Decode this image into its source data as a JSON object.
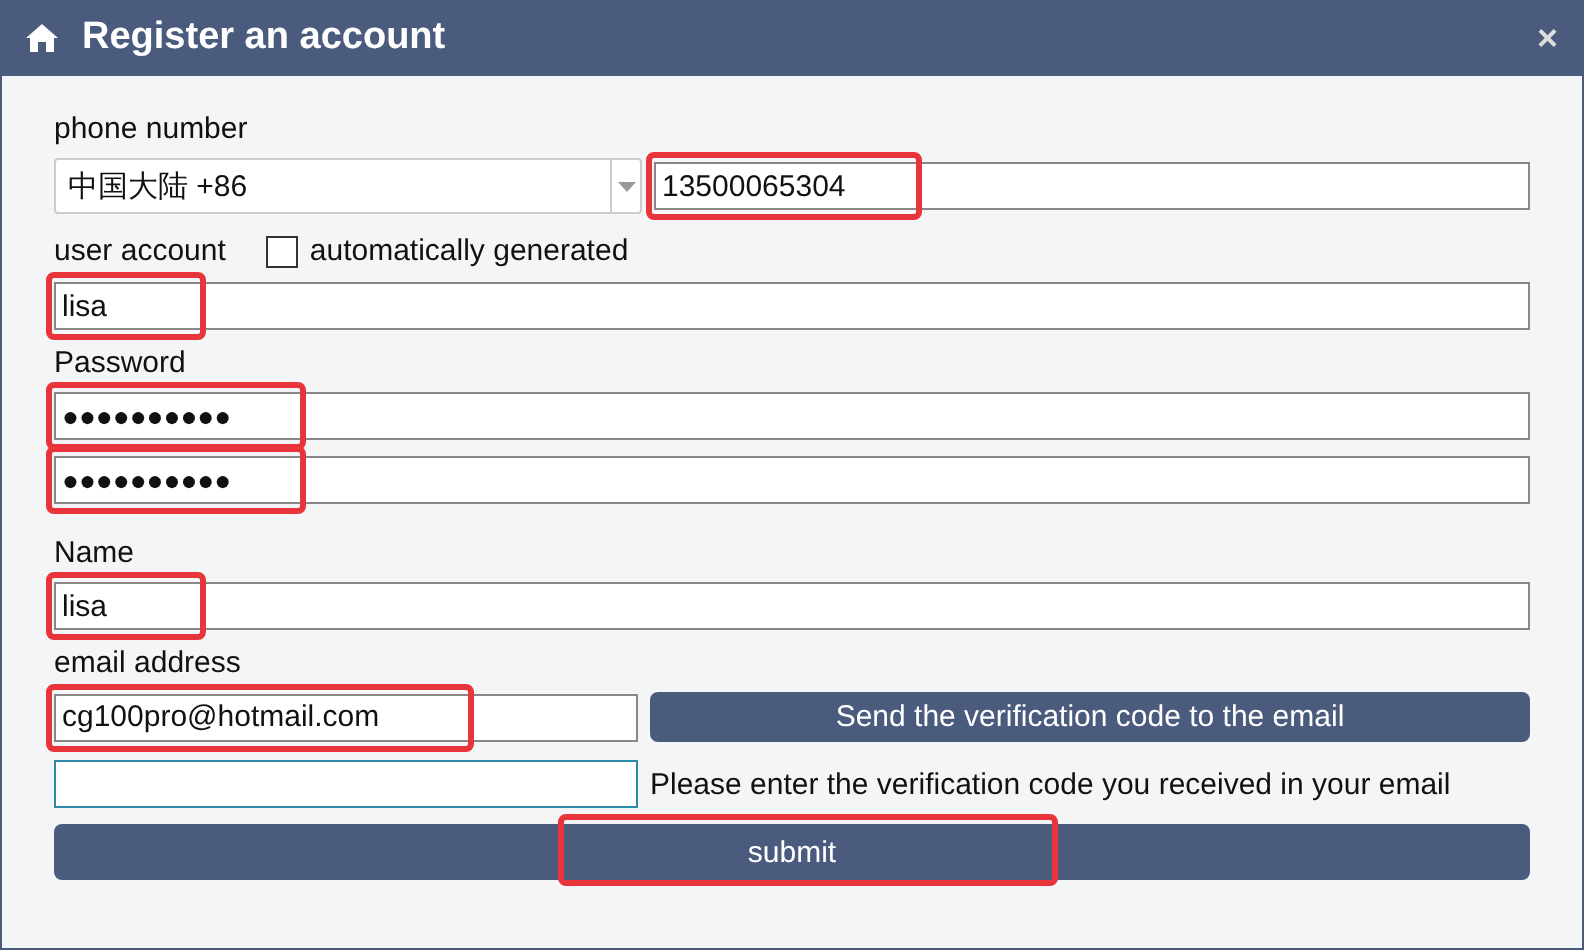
{
  "window": {
    "title": "Register an account",
    "close": "×"
  },
  "phone": {
    "label": "phone number",
    "region": "中国大陆 +86",
    "value": "13500065304",
    "highlighted": true
  },
  "account": {
    "label": "user account",
    "auto_label": "automatically generated",
    "auto_checked": false,
    "value": "lisa",
    "highlighted": true
  },
  "password": {
    "label": "Password",
    "fields": [
      {
        "value": "●●●●●●●●●●",
        "highlighted": true
      },
      {
        "value": "●●●●●●●●●●",
        "highlighted": true
      }
    ]
  },
  "name": {
    "label": "Name",
    "value": "lisa",
    "highlighted": true
  },
  "email": {
    "label": "email address",
    "value": "cg100pro@hotmail.com",
    "highlighted": true,
    "send_button": "Send the verification code to the email",
    "code_hint": "Please enter the verification code you received in your email"
  },
  "submit": {
    "label": "submit",
    "highlighted": true
  }
}
